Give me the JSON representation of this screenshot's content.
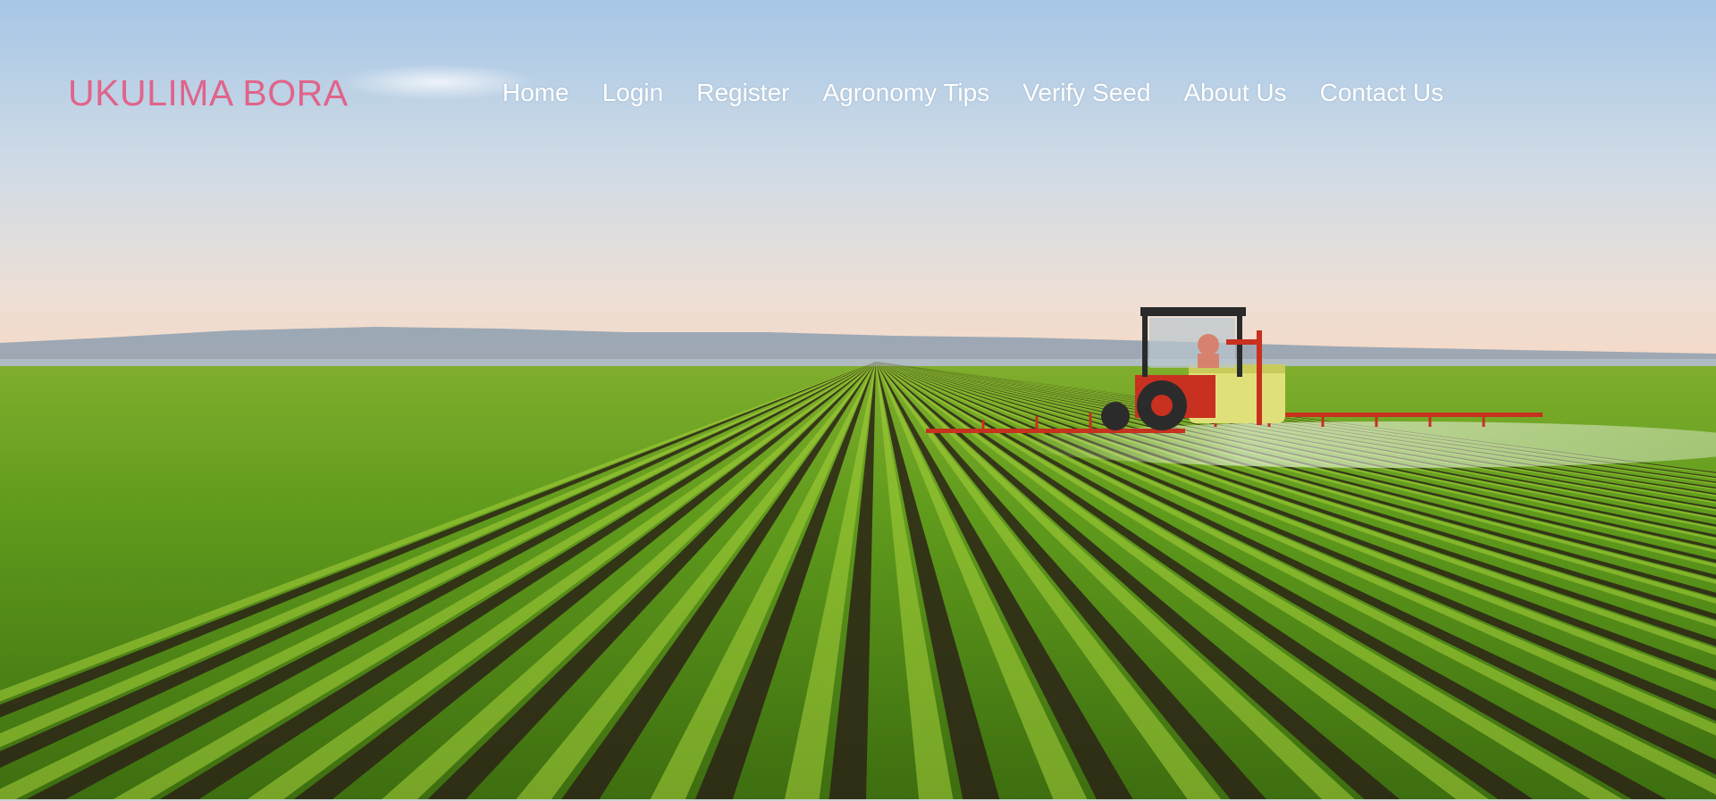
{
  "site": {
    "brand": "UKULIMA BORA",
    "brand_color": "#e0648a"
  },
  "nav": {
    "items": [
      {
        "label": "Home",
        "name": "nav-home"
      },
      {
        "label": "Login",
        "name": "nav-login"
      },
      {
        "label": "Register",
        "name": "nav-register"
      },
      {
        "label": "Agronomy Tips",
        "name": "nav-agronomy-tips"
      },
      {
        "label": "Verify Seed",
        "name": "nav-verify-seed"
      },
      {
        "label": "About Us",
        "name": "nav-about-us"
      },
      {
        "label": "Contact Us",
        "name": "nav-contact-us"
      }
    ],
    "link_color": "#ffffff"
  },
  "hero": {
    "image_subject": "tractor-spraying-soybean-field",
    "colors": {
      "sky_top": "#a9c8e6",
      "sky_bottom": "#f3d8c8",
      "field": "#5f9a1c",
      "soil": "#2b2316",
      "tractor": "#c8301f"
    }
  }
}
